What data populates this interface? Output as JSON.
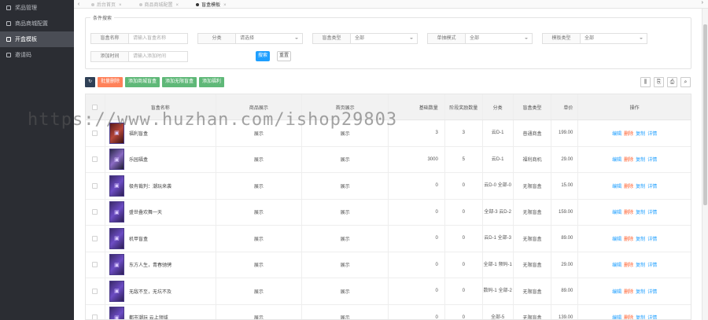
{
  "sidebar": {
    "items": [
      {
        "label": "奖品管理",
        "active": false
      },
      {
        "label": "商品商城配置",
        "active": false
      },
      {
        "label": "开盒模板",
        "active": true
      },
      {
        "label": "邀请码",
        "active": false
      }
    ]
  },
  "tabs": [
    {
      "label": "后台首页",
      "active": false
    },
    {
      "label": "商品商城配置",
      "active": false
    },
    {
      "label": "盲盒模板",
      "active": true
    }
  ],
  "filter": {
    "legend": "条件搜索",
    "fields": [
      {
        "label": "盲盒名称",
        "placeholder": "请输入盲盒名称",
        "type": "input"
      },
      {
        "label": "分类",
        "value": "请选择",
        "type": "select"
      },
      {
        "label": "盲盒类型",
        "value": "全部",
        "type": "select"
      },
      {
        "label": "单抽模式",
        "value": "全部",
        "type": "select"
      },
      {
        "label": "模板类型",
        "value": "全部",
        "type": "select"
      },
      {
        "label": "添加时间",
        "placeholder": "请输入添加时间",
        "type": "input"
      }
    ],
    "search_label": "搜索",
    "reset_label": "重置"
  },
  "toolbar": {
    "refresh_icon": "refresh-icon",
    "delete_label": "批量删除",
    "add_buttons": [
      "添加商城盲盒",
      "添加无限盲盒",
      "添加福利"
    ]
  },
  "table": {
    "headers": [
      "盲盒名称",
      "商品展示",
      "首页展示",
      "基础数量",
      "阶段奖励数量",
      "分类",
      "盲盒类型",
      "单价",
      "操作"
    ],
    "rows": [
      {
        "name": "福利盲盒",
        "shop": "展示",
        "home": "展示",
        "base": "3",
        "stage": "3",
        "cat": "云D-1",
        "type": "普通商盒",
        "price": "199.00"
      },
      {
        "name": "乐园福盒",
        "shop": "展示",
        "home": "展示",
        "base": "3000",
        "stage": "5",
        "cat": "云D-1",
        "type": "福利商机",
        "price": "29.00"
      },
      {
        "name": "极有裁判：潮玩来袭",
        "shop": "展示",
        "home": "展示",
        "base": "0",
        "stage": "0",
        "cat": "云D-0 全部-0",
        "type": "无限盲盒",
        "price": "15.00"
      },
      {
        "name": "盛世叠欢舞一天",
        "shop": "展示",
        "home": "展示",
        "base": "0",
        "stage": "0",
        "cat": "全部-3 云D-2",
        "type": "无限盲盒",
        "price": "159.00"
      },
      {
        "name": "机甲盲盒",
        "shop": "展示",
        "home": "展示",
        "base": "0",
        "stage": "0",
        "cat": "云D-1 全部-3",
        "type": "无限盲盒",
        "price": "89.00"
      },
      {
        "name": "东方人生，青春驰骋",
        "shop": "展示",
        "home": "展示",
        "base": "0",
        "stage": "0",
        "cat": "全部-1 频码-1",
        "type": "无限盲盒",
        "price": "29.00"
      },
      {
        "name": "无敌不至，无坑不及",
        "shop": "展示",
        "home": "展示",
        "base": "0",
        "stage": "0",
        "cat": "数码-1 全部-2",
        "type": "无限盲盒",
        "price": "89.00"
      },
      {
        "name": "都市潮玩 云上领域",
        "shop": "展示",
        "home": "展示",
        "base": "0",
        "stage": "0",
        "cat": "全部-5",
        "type": "无限盲盒",
        "price": "139.00"
      }
    ],
    "ops": [
      "编辑",
      "删除",
      "复制",
      "详情"
    ]
  },
  "watermark": "https://www.huzhan.com/ishop29803",
  "colors": {
    "primary": "#1e9fff",
    "danger": "#ff5722",
    "success": "#5fb878",
    "sidebar": "#2b2d33"
  }
}
